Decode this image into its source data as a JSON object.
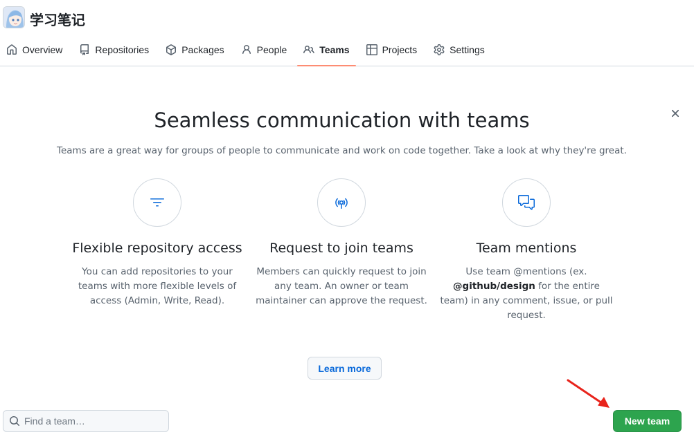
{
  "org": {
    "name": "学习笔记",
    "avatar_icon": "anime-avatar"
  },
  "nav": {
    "items": [
      {
        "label": "Overview",
        "icon": "home-icon",
        "selected": false
      },
      {
        "label": "Repositories",
        "icon": "repo-icon",
        "selected": false
      },
      {
        "label": "Packages",
        "icon": "package-icon",
        "selected": false
      },
      {
        "label": "People",
        "icon": "person-icon",
        "selected": false
      },
      {
        "label": "Teams",
        "icon": "people-icon",
        "selected": true
      },
      {
        "label": "Projects",
        "icon": "table-icon",
        "selected": false
      },
      {
        "label": "Settings",
        "icon": "gear-icon",
        "selected": false
      }
    ]
  },
  "blankslate": {
    "title": "Seamless communication with teams",
    "subtitle": "Teams are a great way for groups of people to communicate and work on code together. Take a look at why they're great.",
    "features": [
      {
        "icon": "filter-icon",
        "title": "Flexible repository access",
        "description": "You can add repositories to your teams with more flexible levels of access (Admin, Write, Read)."
      },
      {
        "icon": "broadcast-icon",
        "title": "Request to join teams",
        "description": "Members can quickly request to join any team. An owner or team maintainer can approve the request."
      },
      {
        "icon": "comment-discussion-icon",
        "title": "Team mentions",
        "description_before": "Use team @mentions (ex.",
        "description_bold": "@github/design",
        "description_after": "for the entire team) in any comment, issue, or pull request."
      }
    ],
    "learn_more_label": "Learn more"
  },
  "search": {
    "placeholder": "Find a team…",
    "value": ""
  },
  "new_team_label": "New team",
  "colors": {
    "accent": "#0969da",
    "primary_button": "#2da44e",
    "tab_underline": "#fd8c73",
    "annotation_arrow": "#e8231b"
  }
}
